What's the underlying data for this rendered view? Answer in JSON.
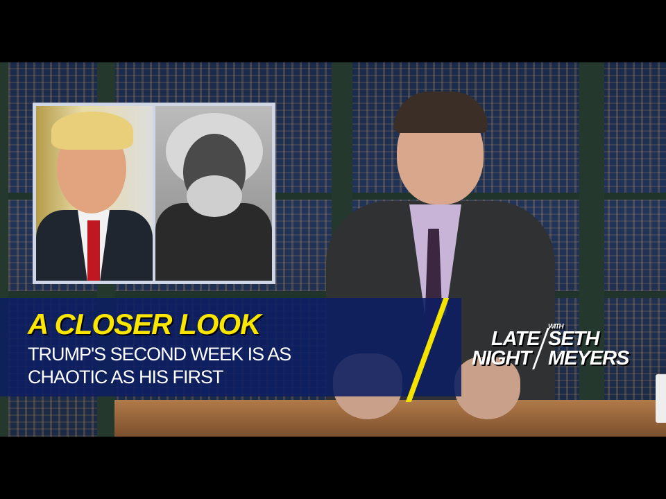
{
  "banner": {
    "title": "A CLOSER LOOK",
    "subtitle_line1": "TRUMP'S SECOND WEEK IS AS",
    "subtitle_line2": "CHAOTIC AS HIS FIRST"
  },
  "logo": {
    "line1": "LATE",
    "line2": "NIGHT",
    "with": "WITH",
    "line3": "SETH",
    "line4": "MEYERS"
  },
  "colors": {
    "banner_bg": "#0c1e62",
    "accent_yellow": "#f5e400"
  }
}
